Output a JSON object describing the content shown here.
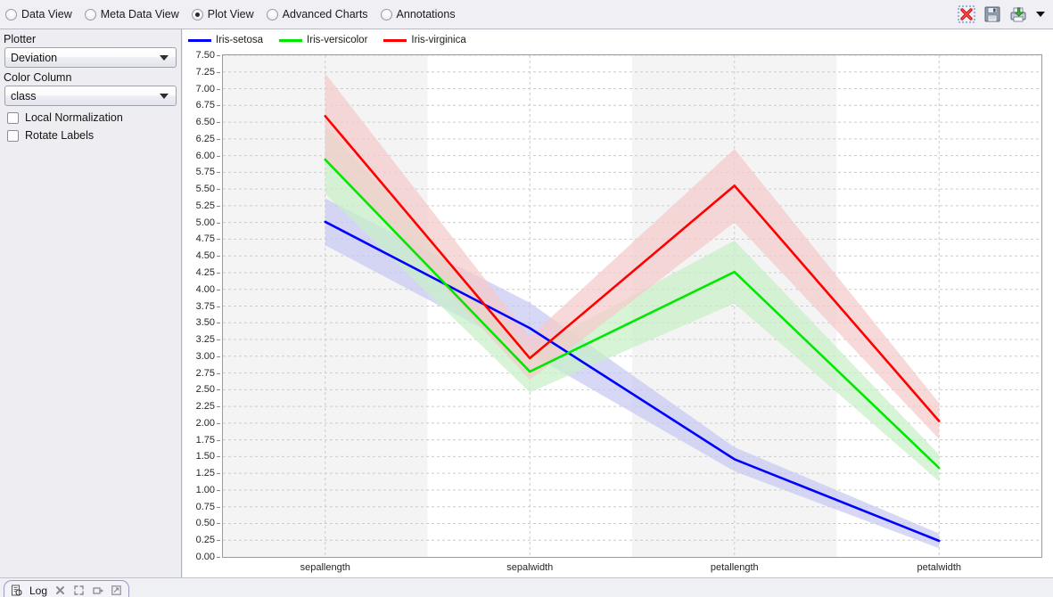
{
  "topbar": {
    "views": [
      {
        "label": "Data View",
        "selected": false,
        "name": "radio-data-view"
      },
      {
        "label": "Meta Data View",
        "selected": false,
        "name": "radio-meta-data-view"
      },
      {
        "label": "Plot View",
        "selected": true,
        "name": "radio-plot-view"
      },
      {
        "label": "Advanced Charts",
        "selected": false,
        "name": "radio-advanced-charts"
      },
      {
        "label": "Annotations",
        "selected": false,
        "name": "radio-annotations"
      }
    ],
    "icons": [
      {
        "name": "delete-icon",
        "title": "Delete"
      },
      {
        "name": "save-icon",
        "title": "Save"
      },
      {
        "name": "export-icon",
        "title": "Export"
      },
      {
        "name": "chevron-down-icon",
        "title": "More"
      }
    ]
  },
  "sidebar": {
    "plotter_label": "Plotter",
    "plotter_value": "Deviation",
    "color_column_label": "Color Column",
    "color_column_value": "class",
    "local_normalization_label": "Local Normalization",
    "local_normalization_checked": false,
    "rotate_labels_label": "Rotate Labels",
    "rotate_labels_checked": false
  },
  "bottom": {
    "log_label": "Log",
    "icons": [
      "close-icon",
      "maximize-icon",
      "float-icon",
      "restore-icon"
    ]
  },
  "colors": {
    "setosa": "#0000ff",
    "versicolor": "#00e800",
    "virginica": "#ff0000",
    "setosa_band": "#c8c8f2",
    "versicolor_band": "#c8f0c8",
    "virginica_band": "#f5cbcb",
    "column_band": "#f4f4f4",
    "grid": "#cccccc"
  },
  "chart_data": {
    "type": "line",
    "title": "",
    "xlabel": "",
    "ylabel": "",
    "grid": true,
    "legend_position": "top-left",
    "categories": [
      "sepallength",
      "sepalwidth",
      "petallength",
      "petalwidth"
    ],
    "ylim": [
      0.0,
      7.5
    ],
    "ytick_step": 0.25,
    "yticks": [
      "0.00",
      "0.25",
      "0.50",
      "0.75",
      "1.00",
      "1.25",
      "1.50",
      "1.75",
      "2.00",
      "2.25",
      "2.50",
      "2.75",
      "3.00",
      "3.25",
      "3.50",
      "3.75",
      "4.00",
      "4.25",
      "4.50",
      "4.75",
      "5.00",
      "5.25",
      "5.50",
      "5.75",
      "6.00",
      "6.25",
      "6.50",
      "6.75",
      "7.00",
      "7.25",
      "7.50"
    ],
    "series": [
      {
        "name": "Iris-setosa",
        "color": "#0000ff",
        "band_color": "#c8c8f2",
        "values": [
          5.01,
          3.42,
          1.46,
          0.24
        ],
        "upper": [
          5.36,
          3.8,
          1.64,
          0.35
        ],
        "lower": [
          4.66,
          3.04,
          1.28,
          0.13
        ]
      },
      {
        "name": "Iris-versicolor",
        "color": "#00e800",
        "band_color": "#c8f0c8",
        "values": [
          5.94,
          2.77,
          4.26,
          1.33
        ],
        "upper": [
          6.45,
          3.08,
          4.73,
          1.53
        ],
        "lower": [
          5.43,
          2.46,
          3.79,
          1.13
        ]
      },
      {
        "name": "Iris-virginica",
        "color": "#ff0000",
        "band_color": "#f5cbcb",
        "values": [
          6.59,
          2.97,
          5.55,
          2.03
        ],
        "upper": [
          7.23,
          3.29,
          6.1,
          2.3
        ],
        "lower": [
          5.95,
          2.65,
          5.0,
          1.76
        ]
      }
    ]
  }
}
